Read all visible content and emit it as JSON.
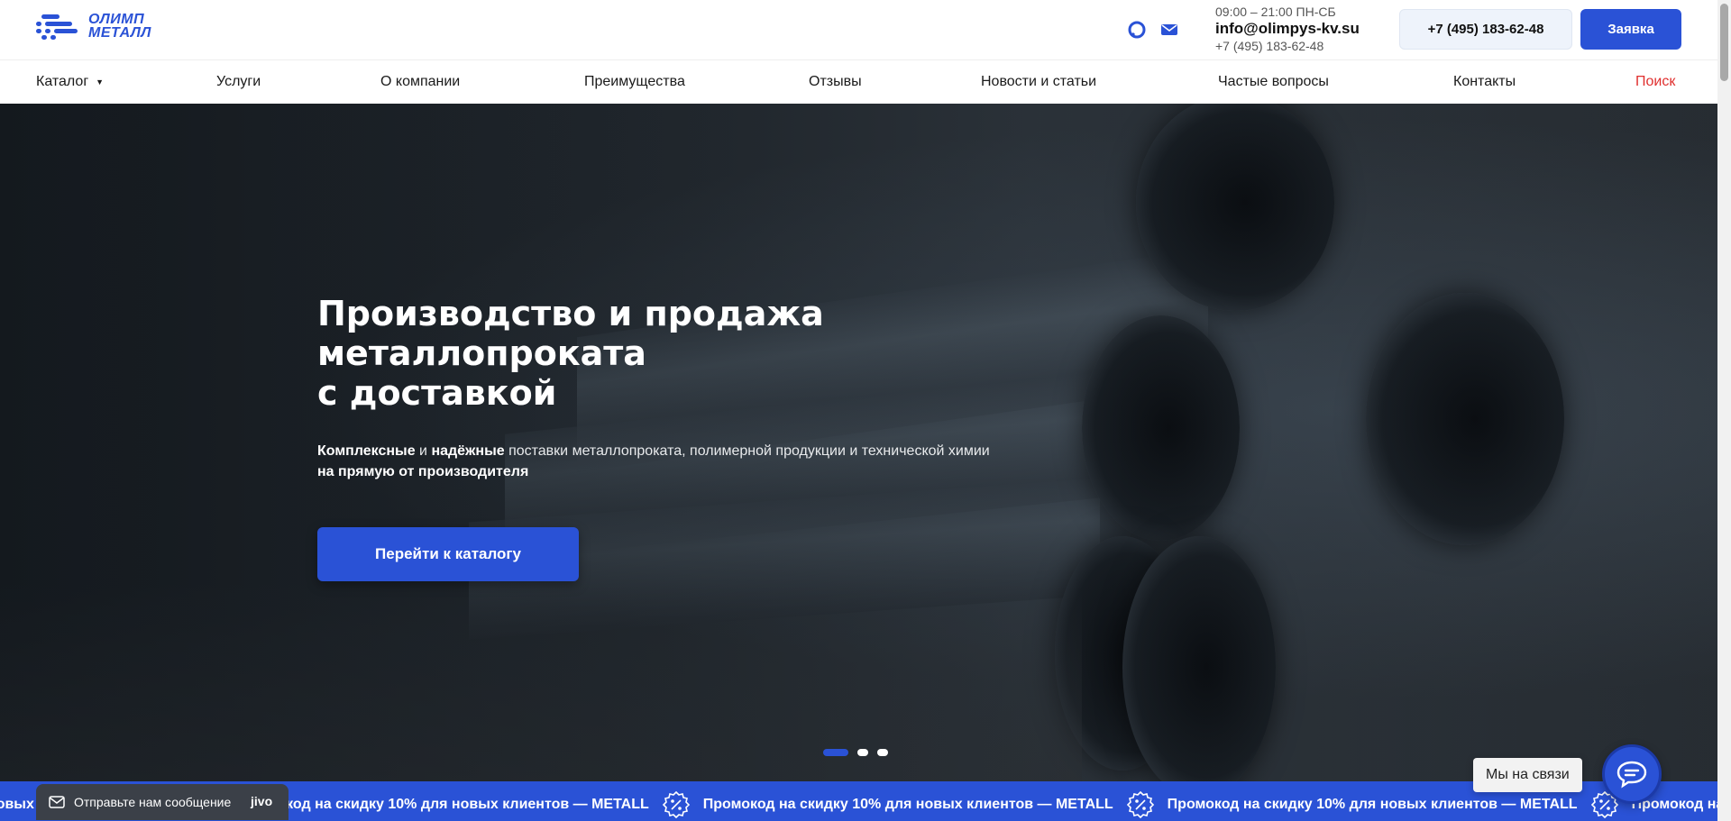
{
  "logo": {
    "line1": "ОЛИМП",
    "line2": "МЕТАЛЛ",
    "brand_color": "#2a52d6"
  },
  "header": {
    "icons": [
      "chat-icon",
      "mail-icon"
    ],
    "hours": "09:00 – 21:00 ПН-СБ",
    "email": "info@olimpys-kv.su",
    "phone": "+7 (495) 183-62-48",
    "phone_button": "+7 (495) 183-62-48",
    "order_button": "Заявка"
  },
  "nav": {
    "items": [
      {
        "label": "Каталог",
        "has_dropdown": true
      },
      {
        "label": "Услуги"
      },
      {
        "label": "О компании"
      },
      {
        "label": "Преимущества"
      },
      {
        "label": "Отзывы"
      },
      {
        "label": "Новости и статьи"
      },
      {
        "label": "Частые вопросы"
      },
      {
        "label": "Контакты"
      },
      {
        "label": "Поиск",
        "color": "#e0302f"
      }
    ]
  },
  "hero": {
    "title_lines": [
      "Производство и продажа",
      "металлопроката",
      "с доставкой"
    ],
    "subtitle": {
      "b1": "Комплексные",
      "t1": " и ",
      "b2": "надёжные",
      "t2": " поставки металлопроката, полимерной продукции и технической химии ",
      "b3": "на прямую от производителя"
    },
    "cta": "Перейти к каталогу",
    "slides": {
      "count": 3,
      "active": 1
    }
  },
  "promo": {
    "text": "Промокод на скидку 10% для новых клиентов — METALL",
    "icon": "percent-badge-icon"
  },
  "jivo": {
    "send_message": "Отправьте нам сообщение",
    "brand": "jivo",
    "online_label": "Мы на связи"
  }
}
